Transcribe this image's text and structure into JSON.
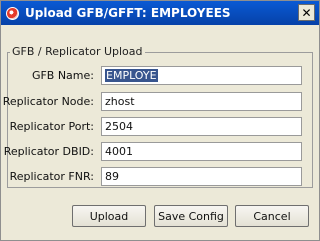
{
  "window": {
    "title": "Upload GFB/GFFT: EMPLOYEES",
    "close_glyph": "✕",
    "app_icon": "app-icon"
  },
  "form": {
    "group_label": "GFB / Replicator Upload",
    "fields": [
      {
        "label": "GFB Name:",
        "value": "EMPLOYE",
        "selected": true
      },
      {
        "label": "Replicator Node:",
        "value": "zhost"
      },
      {
        "label": "Replicator Port:",
        "value": "2504"
      },
      {
        "label": "Replicator DBID:",
        "value": "4001"
      },
      {
        "label": "Replicator FNR:",
        "value": "89"
      }
    ]
  },
  "buttons": {
    "upload": "Upload",
    "save_config": "Save Config",
    "cancel": "Cancel"
  },
  "colors": {
    "titlebar": "#0a5ad4",
    "dialog_bg": "#ece9d8",
    "selection": "#38558e"
  }
}
